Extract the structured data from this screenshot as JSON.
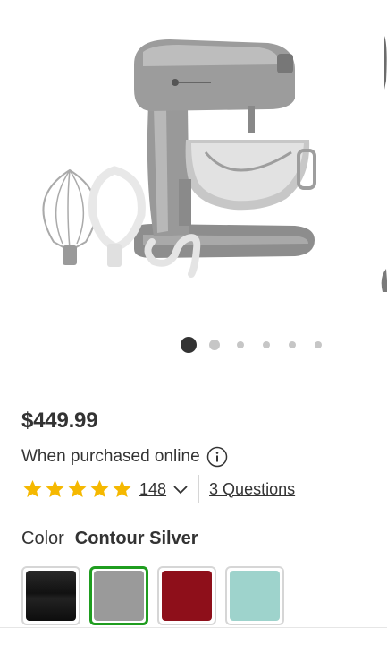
{
  "product": {
    "image_alt": "Stand mixer with whisk, flat beater and dough hook attachments",
    "price": "$449.99",
    "purchase_note": "When purchased online",
    "rating": {
      "stars": 5,
      "count_label": "148"
    },
    "questions_label": "3 Questions",
    "color": {
      "label": "Color",
      "selected_name": "Contour Silver",
      "swatches": [
        {
          "name": "black",
          "hex": "#1c1c1c"
        },
        {
          "name": "contour-silver",
          "hex": "#9a9a9a"
        },
        {
          "name": "red",
          "hex": "#8e0f1a"
        },
        {
          "name": "aqua",
          "hex": "#9ed3cc"
        }
      ],
      "selected_index": 1
    }
  },
  "carousel": {
    "total": 6,
    "active_index": 0
  },
  "colors": {
    "star": "#f5b800",
    "selected_outline": "#1f9d1f",
    "text": "#333333"
  }
}
